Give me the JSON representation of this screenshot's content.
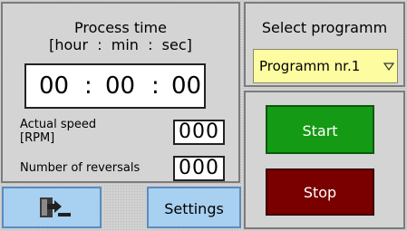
{
  "process": {
    "title": "Process time",
    "units": "[hour  :  min  :  sec]",
    "hours": "00",
    "minutes": "00",
    "seconds": "00",
    "separator": ":"
  },
  "speed": {
    "label": "Actual speed [RPM]",
    "value": "000"
  },
  "reversals": {
    "label": "Number of reversals",
    "value": "000"
  },
  "program": {
    "title": "Select programm",
    "selected": "Programm nr.1"
  },
  "buttons": {
    "start": "Start",
    "stop": "Stop",
    "settings": "Settings",
    "exit_icon": "exit-icon"
  },
  "colors": {
    "start": "#149a14",
    "stop": "#7a0000",
    "selector": "#fdfca0",
    "nav_button": "#a8d0f0"
  }
}
